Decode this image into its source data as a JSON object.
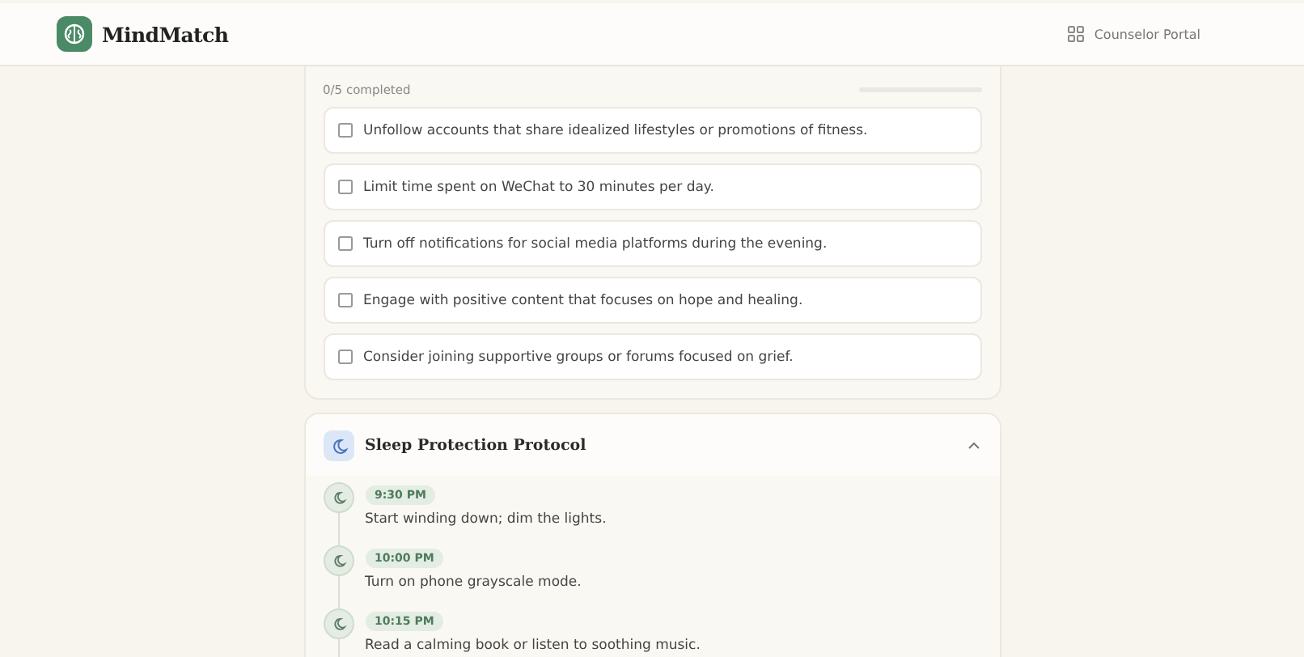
{
  "header": {
    "brand": "MindMatch",
    "portal_link": "Counselor Portal"
  },
  "checklist": {
    "progress_text": "0/5 completed",
    "progress": {
      "level": 0
    },
    "items": [
      {
        "text": "Unfollow accounts that share idealized lifestyles or promotions of fitness.",
        "checked": false
      },
      {
        "text": "Limit time spent on WeChat to 30 minutes per day.",
        "checked": false
      },
      {
        "text": "Turn off notifications for social media platforms during the evening.",
        "checked": false
      },
      {
        "text": "Engage with positive content that focuses on hope and healing.",
        "checked": false
      },
      {
        "text": "Consider joining supportive groups or forums focused on grief.",
        "checked": false
      }
    ]
  },
  "protocol": {
    "title": "Sleep Protection Protocol",
    "expanded": true,
    "steps": [
      {
        "time": "9:30 PM",
        "text": "Start winding down; dim the lights."
      },
      {
        "time": "10:00 PM",
        "text": "Turn on phone grayscale mode."
      },
      {
        "time": "10:15 PM",
        "text": "Read a calming book or listen to soothing music."
      }
    ]
  }
}
